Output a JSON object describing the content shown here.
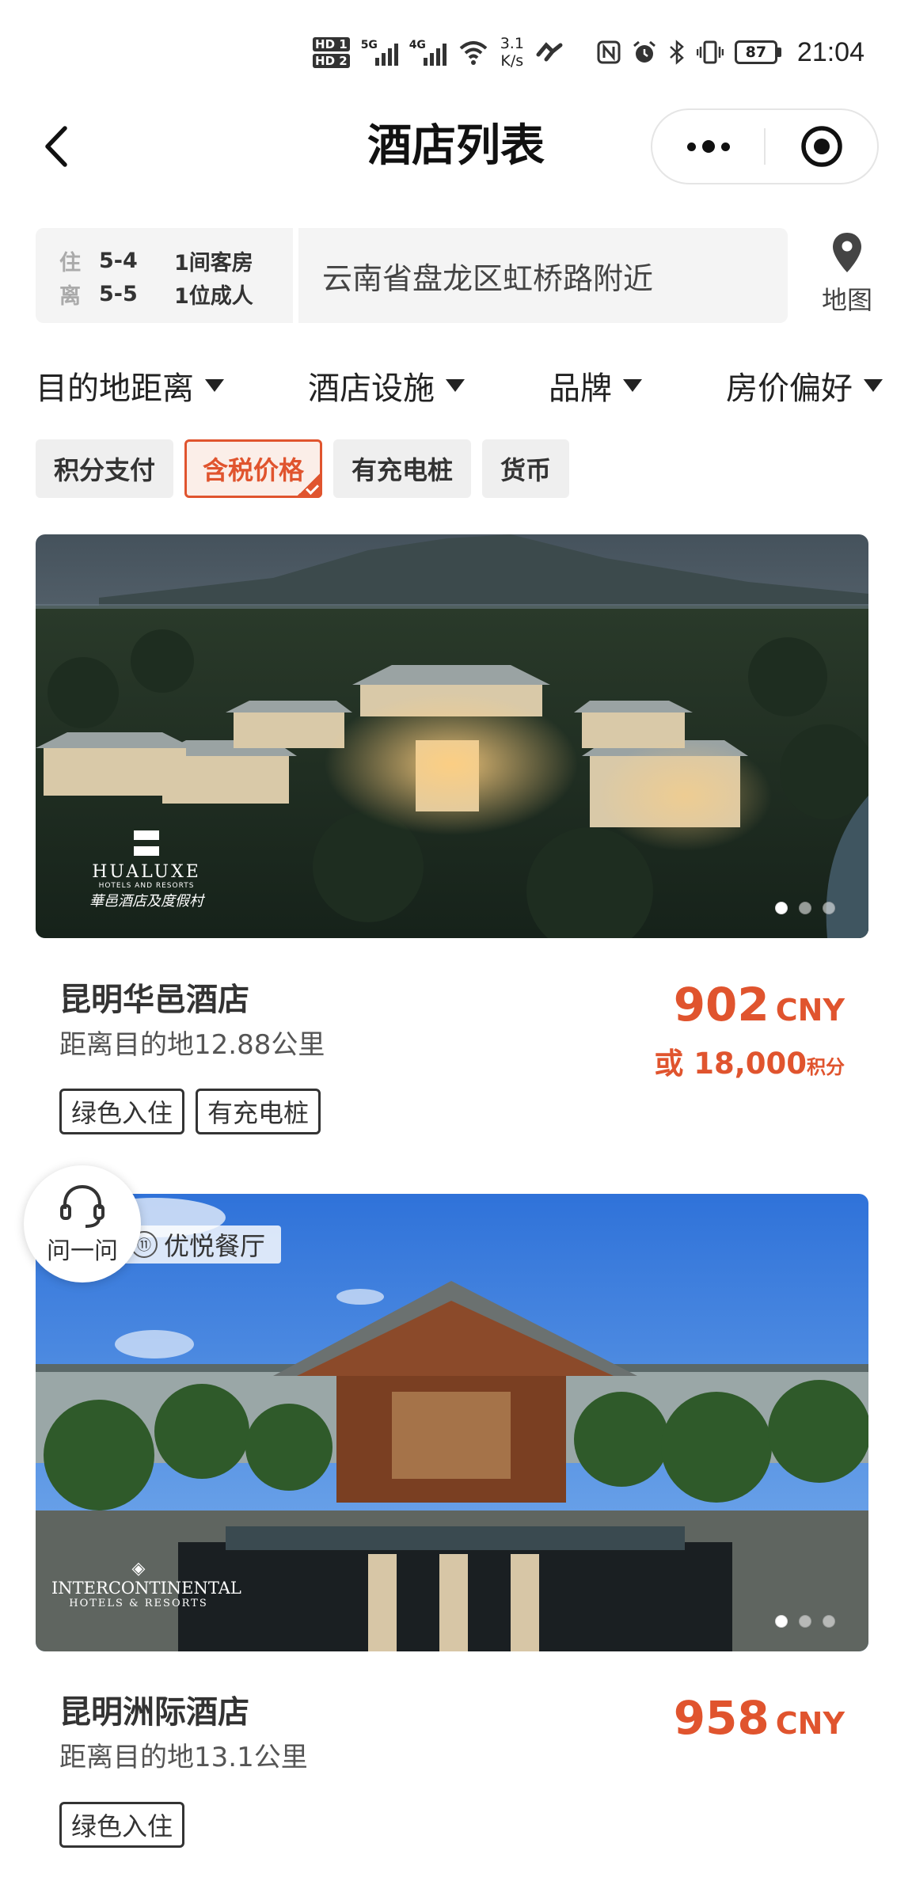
{
  "status_bar": {
    "hd1": "HD 1",
    "hd2": "HD 2",
    "sig1_gen": "5G",
    "sig2_gen": "4G",
    "net_speed_value": "3.1",
    "net_speed_unit": "K/s",
    "battery": "87",
    "time": "21:04",
    "icons": [
      "nfc-icon",
      "alarm-icon",
      "bluetooth-icon",
      "vibrate-icon"
    ]
  },
  "nav": {
    "title": "酒店列表",
    "back_icon": "chevron-left-icon",
    "more_icon": "more-dots-icon",
    "close_icon": "target-close-icon"
  },
  "search": {
    "checkin_label": "住",
    "checkin_date": "5-4",
    "rooms": "1间客房",
    "checkout_label": "离",
    "checkout_date": "5-5",
    "guests": "1位成人",
    "location": "云南省盘龙区虹桥路附近",
    "map_label": "地图"
  },
  "filters": [
    {
      "label": "目的地距离"
    },
    {
      "label": "酒店设施"
    },
    {
      "label": "品牌"
    },
    {
      "label": "房价偏好"
    }
  ],
  "chips": [
    {
      "label": "积分支付",
      "active": false
    },
    {
      "label": "含税价格",
      "active": true
    },
    {
      "label": "有充电桩",
      "active": false
    },
    {
      "label": "货币",
      "active": false
    }
  ],
  "hotels": [
    {
      "name": "昆明华邑酒店",
      "distance": "距离目的地12.88公里",
      "tags": [
        "绿色入住",
        "有充电桩"
      ],
      "price": "902",
      "currency": "CNY",
      "points_prefix": "或",
      "points": "18,000",
      "points_unit": "积分",
      "brand_line1": "HUALUXE",
      "brand_line2": "HOTELS AND RESORTS",
      "brand_line3": "華邑酒店及度假村"
    },
    {
      "name": "昆明洲际酒店",
      "distance": "距离目的地13.1公里",
      "tags": [
        "绿色入住"
      ],
      "price": "958",
      "currency": "CNY",
      "badge": "优悦餐厅",
      "brand_line1": "INTERCONTINENTAL",
      "brand_line2": "HOTELS & RESORTS"
    }
  ],
  "help": {
    "label": "问一问"
  }
}
